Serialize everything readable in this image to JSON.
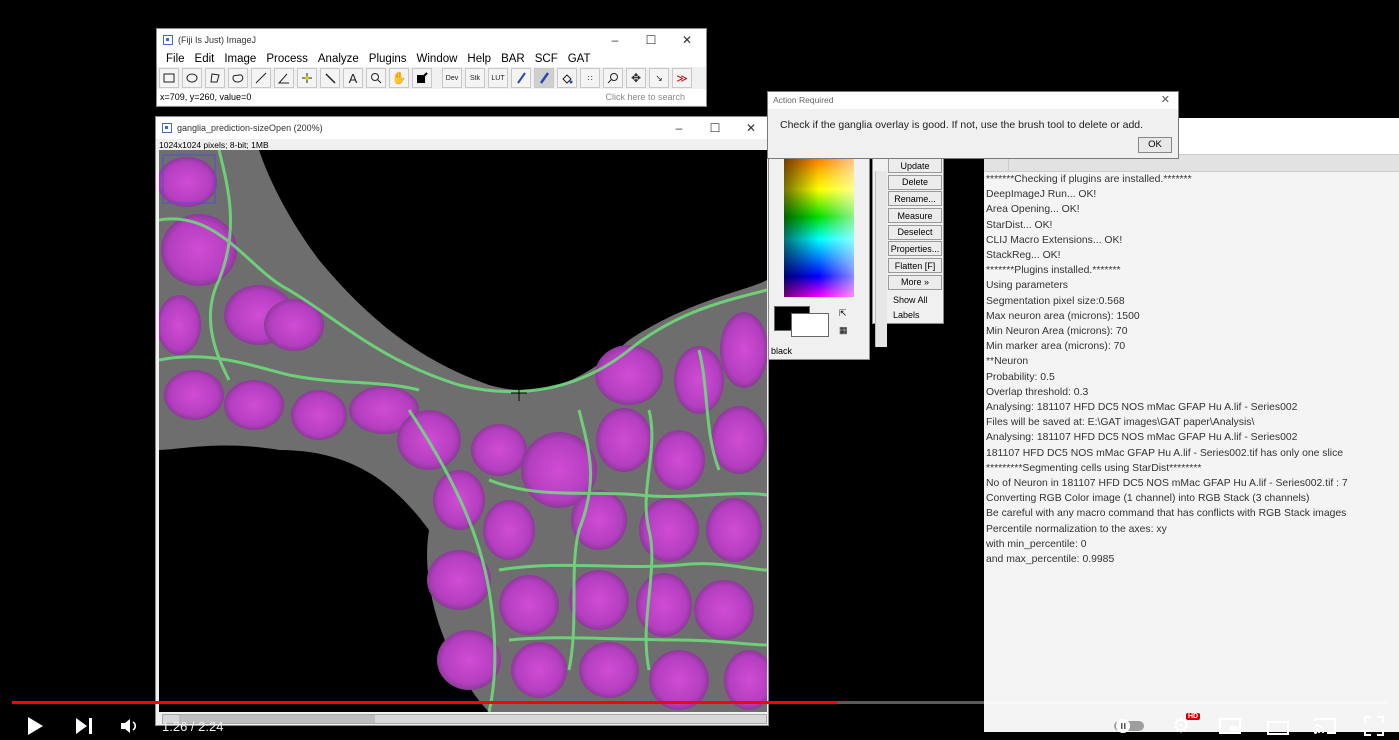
{
  "fiji": {
    "title": "(Fiji Is Just) ImageJ",
    "menu": [
      "File",
      "Edit",
      "Image",
      "Process",
      "Analyze",
      "Plugins",
      "Window",
      "Help",
      "BAR",
      "SCF",
      "GAT"
    ],
    "tools": [
      "rect-tool",
      "oval-tool",
      "polygon-tool",
      "freehand-tool",
      "line-tool",
      "angle-tool",
      "point-tool",
      "wand-tool",
      "text-tool",
      "magnifier-tool",
      "hand-tool",
      "color-picker-tool",
      "dev-tool",
      "stk-tool",
      "lut-tool",
      "pencil-tool",
      "brush-tool",
      "flood-fill-tool",
      "spray-tool",
      "zoom-tool",
      "move-tool",
      "arrow-tool",
      "more-tools"
    ],
    "tool_labels": {
      "dev": "Dev",
      "stk": "Stk",
      "lut": "LUT",
      "more": "≫"
    },
    "status": "x=709, y=260, value=0",
    "search_placeholder": "Click here to search"
  },
  "image_window": {
    "title": "ganglia_prediction-sizeOpen (200%)",
    "info": "1024x1024 pixels; 8-bit; 1MB"
  },
  "dialog": {
    "title": "Action Required",
    "message": "Check if the ganglia overlay is good. If not, use the brush tool to delete or add.",
    "ok": "OK"
  },
  "color_picker": {
    "label": "black"
  },
  "roi_manager": {
    "buttons": [
      "Update",
      "Delete",
      "Rename...",
      "Measure",
      "Deselect",
      "Properties...",
      "Flatten [F]",
      "More »"
    ],
    "checkboxes": [
      "Show All",
      "Labels"
    ]
  },
  "log": {
    "lines": [
      "*******Checking if plugins are installed.*******",
      "DeepImageJ Run... OK!",
      "Area Opening... OK!",
      "StarDist... OK!",
      "CLIJ Macro Extensions... OK!",
      "StackReg... OK!",
      "*******Plugins installed.*******",
      "Using parameters",
      "Segmentation pixel size:0.568",
      "Max neuron area (microns): 1500",
      "Min Neuron Area (microns): 70",
      "Min marker area (microns): 70",
      "**Neuron",
      "Probability: 0.5",
      "Overlap threshold: 0.3",
      "Analysing: 181107 HFD DC5 NOS mMac GFAP Hu A.lif - Series002",
      "Files will be saved at: E:\\GAT images\\GAT paper\\Analysis\\",
      "Analysing: 181107 HFD DC5 NOS mMac GFAP Hu A.lif - Series002",
      "181107 HFD DC5 NOS mMac GFAP Hu A.lif - Series002.tif has only one slice",
      "*********Segmenting cells using StarDist********",
      "No of Neuron in 181107 HFD DC5 NOS mMac GFAP Hu A.lif - Series002.tif : 7",
      "Converting RGB Color image (1 channel) into RGB Stack (3 channels)",
      "Be careful with any macro command that has conflicts with RGB Stack images",
      "Percentile normalization to the axes: xy",
      "with min_percentile: 0",
      "and max_percentile: 0.9985"
    ]
  },
  "player": {
    "time": "1:26 / 2:24",
    "progress_fraction": 0.6,
    "hd_badge": "HD",
    "colors": {
      "progress": "#ff0000",
      "hd": "#cc0000"
    }
  }
}
